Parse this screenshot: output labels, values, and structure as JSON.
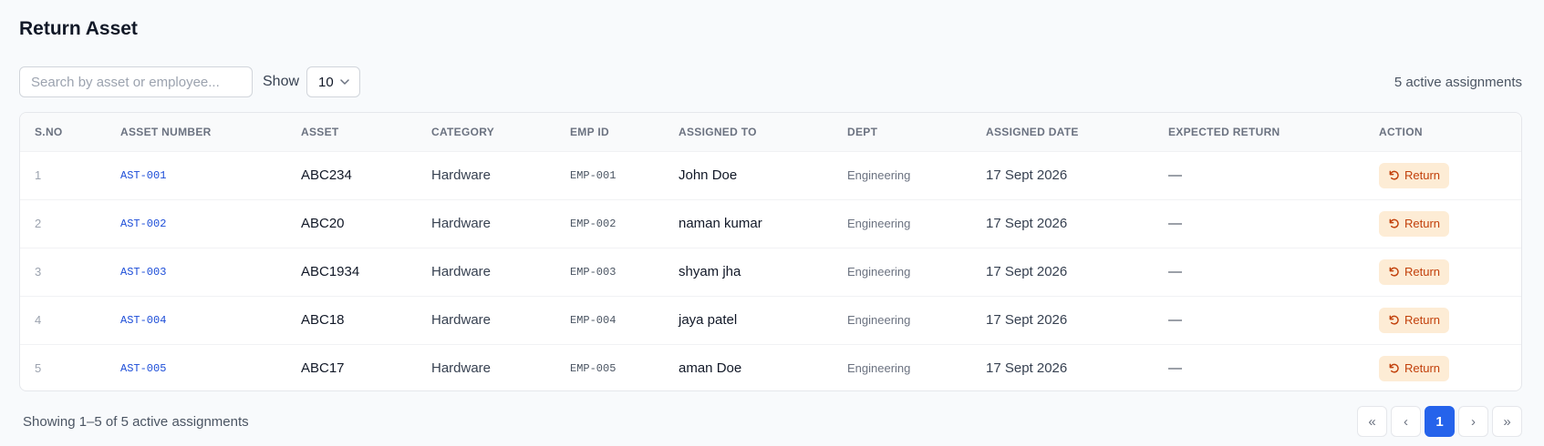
{
  "page": {
    "title": "Return Asset"
  },
  "toolbar": {
    "search_placeholder": "Search by asset or employee...",
    "search_value": "",
    "show_label": "Show",
    "page_size": "10",
    "count_text": "5 active assignments"
  },
  "table": {
    "columns": [
      "S.NO",
      "ASSET NUMBER",
      "ASSET",
      "CATEGORY",
      "EMP ID",
      "ASSIGNED TO",
      "DEPT",
      "ASSIGNED DATE",
      "EXPECTED RETURN",
      "ACTION"
    ],
    "rows": [
      {
        "sno": "1",
        "asset_number": "AST-001",
        "asset": "ABC234",
        "category": "Hardware",
        "emp_id": "EMP-001",
        "assigned_to": "John Doe",
        "dept": "Engineering",
        "assigned_date": "17 Sept 2026",
        "expected_return": "—",
        "action": "Return"
      },
      {
        "sno": "2",
        "asset_number": "AST-002",
        "asset": "ABC20",
        "category": "Hardware",
        "emp_id": "EMP-002",
        "assigned_to": "naman kumar",
        "dept": "Engineering",
        "assigned_date": "17 Sept 2026",
        "expected_return": "—",
        "action": "Return"
      },
      {
        "sno": "3",
        "asset_number": "AST-003",
        "asset": "ABC1934",
        "category": "Hardware",
        "emp_id": "EMP-003",
        "assigned_to": "shyam jha",
        "dept": "Engineering",
        "assigned_date": "17 Sept 2026",
        "expected_return": "—",
        "action": "Return"
      },
      {
        "sno": "4",
        "asset_number": "AST-004",
        "asset": "ABC18",
        "category": "Hardware",
        "emp_id": "EMP-004",
        "assigned_to": "jaya patel",
        "dept": "Engineering",
        "assigned_date": "17 Sept 2026",
        "expected_return": "—",
        "action": "Return"
      },
      {
        "sno": "5",
        "asset_number": "AST-005",
        "asset": "ABC17",
        "category": "Hardware",
        "emp_id": "EMP-005",
        "assigned_to": "aman Doe",
        "dept": "Engineering",
        "assigned_date": "17 Sept 2026",
        "expected_return": "—",
        "action": "Return"
      }
    ]
  },
  "footer": {
    "showing_text": "Showing 1–5 of 5 active assignments",
    "pagination": {
      "first": "«",
      "prev": "‹",
      "current": "1",
      "next": "›",
      "last": "»"
    }
  },
  "icons": {
    "return": "undo-icon",
    "dropdown": "chevron-down-icon"
  },
  "colors": {
    "accent": "#2563eb",
    "link": "#1d4ed8",
    "return_bg": "#fdecd5",
    "return_fg": "#c2410c"
  }
}
